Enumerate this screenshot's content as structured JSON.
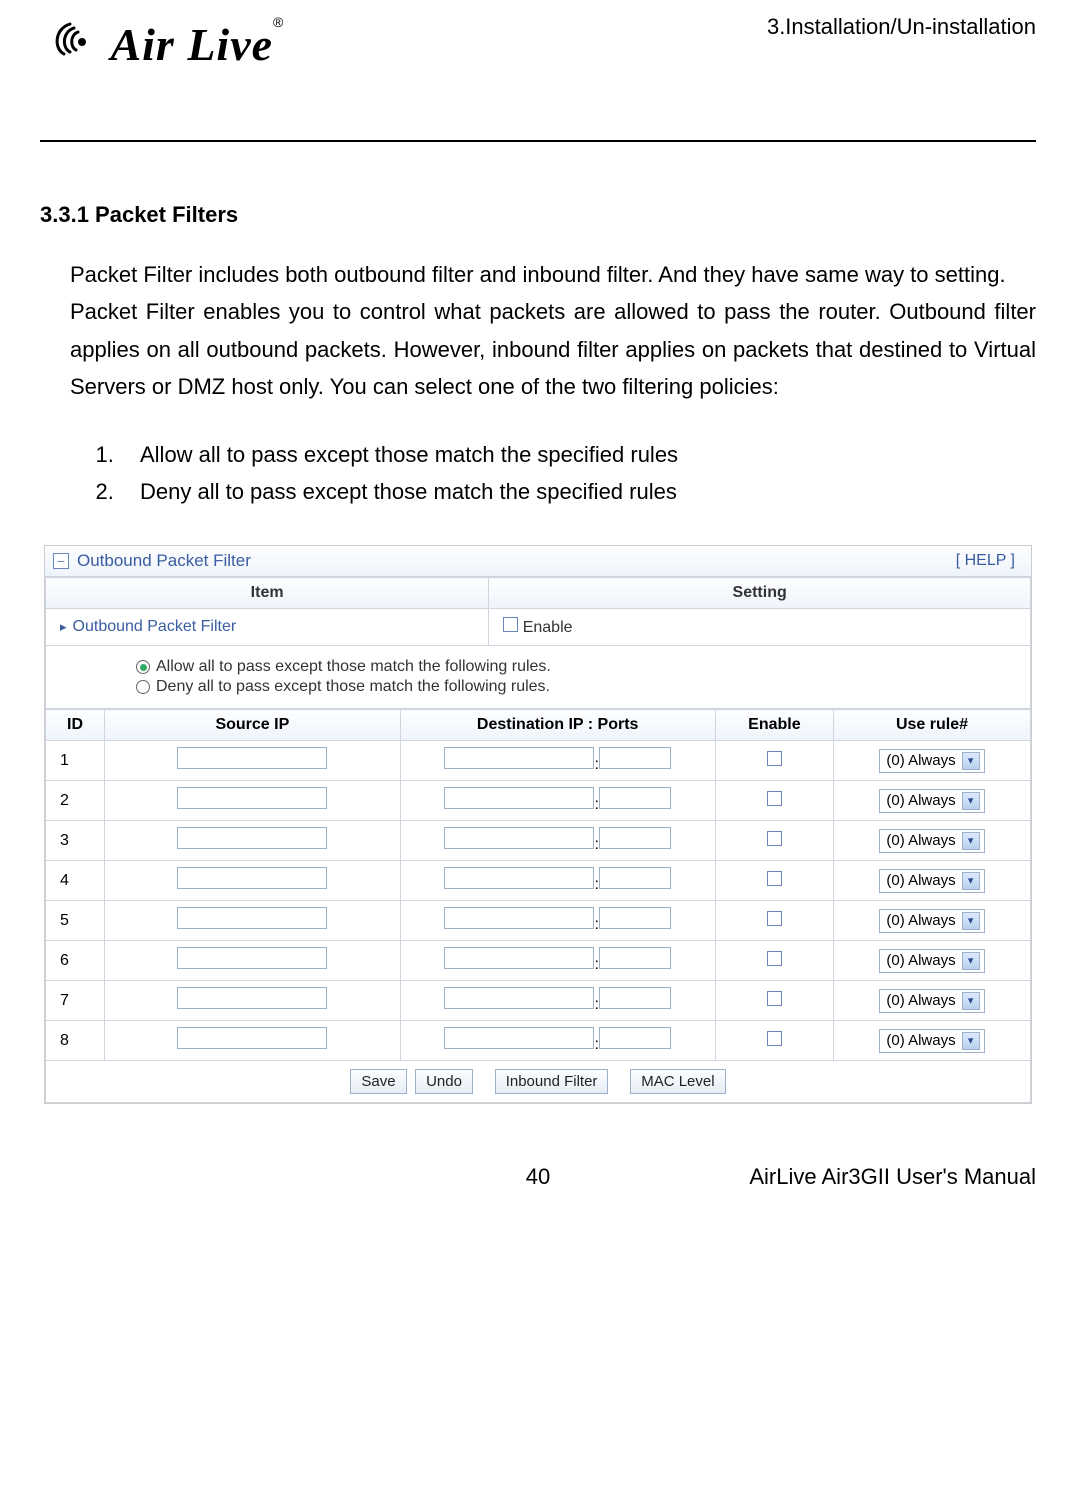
{
  "header": {
    "breadcrumb": "3.Installation/Un-installation",
    "logo_text": "Air Live",
    "logo_reg": "®"
  },
  "section": {
    "heading": "3.3.1 Packet Filters",
    "para1": "Packet Filter includes both outbound filter and inbound filter. And they have same way to setting.",
    "para2": "Packet Filter enables you to control what packets are allowed to pass the router. Outbound filter applies on all outbound packets. However, inbound filter applies on packets that destined to Virtual Servers or DMZ host only. You can select one of the two filtering policies:",
    "policies": [
      "Allow all to pass except those match the specified rules",
      "Deny all to pass except those match the specified rules"
    ]
  },
  "panel": {
    "title": "Outbound Packet Filter",
    "help": "[ HELP ]",
    "item_col": "Item",
    "setting_col": "Setting",
    "opf_label": "Outbound Packet Filter",
    "enable_label": "Enable",
    "radio_allow": "Allow all to pass except those match the following rules.",
    "radio_deny": "Deny all to pass except those match the following rules.",
    "cols": {
      "id": "ID",
      "src": "Source IP",
      "dst": "Destination IP : Ports",
      "enable": "Enable",
      "rule": "Use rule#"
    },
    "rows": [
      {
        "id": "1",
        "rule": "(0) Always"
      },
      {
        "id": "2",
        "rule": "(0) Always"
      },
      {
        "id": "3",
        "rule": "(0) Always"
      },
      {
        "id": "4",
        "rule": "(0) Always"
      },
      {
        "id": "5",
        "rule": "(0) Always"
      },
      {
        "id": "6",
        "rule": "(0) Always"
      },
      {
        "id": "7",
        "rule": "(0) Always"
      },
      {
        "id": "8",
        "rule": "(0) Always"
      }
    ],
    "buttons": {
      "save": "Save",
      "undo": "Undo",
      "inbound": "Inbound Filter",
      "mac": "MAC Level"
    }
  },
  "footer": {
    "page": "40",
    "manual": "AirLive Air3GII User's Manual"
  }
}
